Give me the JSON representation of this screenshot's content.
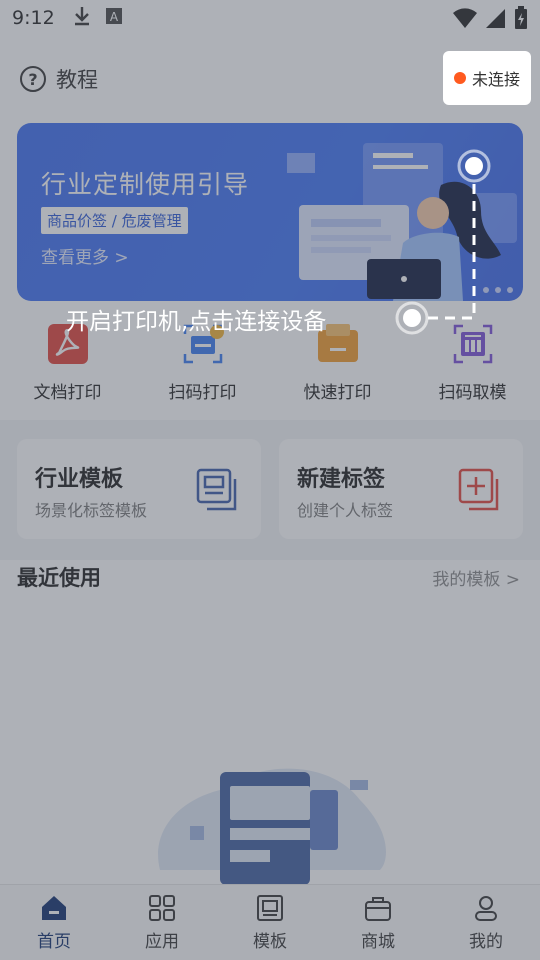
{
  "status_bar": {
    "time": "9:12",
    "icons": [
      "download-icon",
      "a-box-icon",
      "wifi-icon",
      "signal-icon",
      "battery-icon"
    ]
  },
  "header": {
    "tutorial_label": "教程",
    "connection_label": "未连接",
    "connection_dot_color": "#ff5a1f"
  },
  "banner": {
    "title": "行业定制使用引导",
    "tag": "商品价签 / 危废管理",
    "more": "查看更多 >"
  },
  "guide": {
    "text": "开启打印机,点击连接设备"
  },
  "quick_actions": [
    {
      "label": "文档打印",
      "icon": "pdf-doc-icon",
      "color": "#e2423a"
    },
    {
      "label": "扫码打印",
      "icon": "scan-print-icon",
      "color": "#3a7bf0"
    },
    {
      "label": "快速打印",
      "icon": "fast-print-icon",
      "color": "#f29b2b"
    },
    {
      "label": "扫码取模",
      "icon": "scan-template-icon",
      "color": "#7b4fd8"
    }
  ],
  "cards": [
    {
      "title": "行业模板",
      "subtitle": "场景化标签模板",
      "icon": "template-stack-icon",
      "color": "#3a5aa8"
    },
    {
      "title": "新建标签",
      "subtitle": "创建个人标签",
      "icon": "add-label-icon",
      "color": "#e2423a"
    }
  ],
  "recent": {
    "title": "最近使用",
    "more": "我的模板 >"
  },
  "tabs": [
    {
      "label": "首页",
      "icon": "home-icon",
      "active": true
    },
    {
      "label": "应用",
      "icon": "apps-grid-icon",
      "active": false
    },
    {
      "label": "模板",
      "icon": "template-icon",
      "active": false
    },
    {
      "label": "商城",
      "icon": "shop-bag-icon",
      "active": false
    },
    {
      "label": "我的",
      "icon": "user-icon",
      "active": false
    }
  ],
  "colors": {
    "accent": "#3d6df0",
    "tab_active": "#0f2f6e",
    "overlay": "rgba(75,82,96,0.45)"
  }
}
